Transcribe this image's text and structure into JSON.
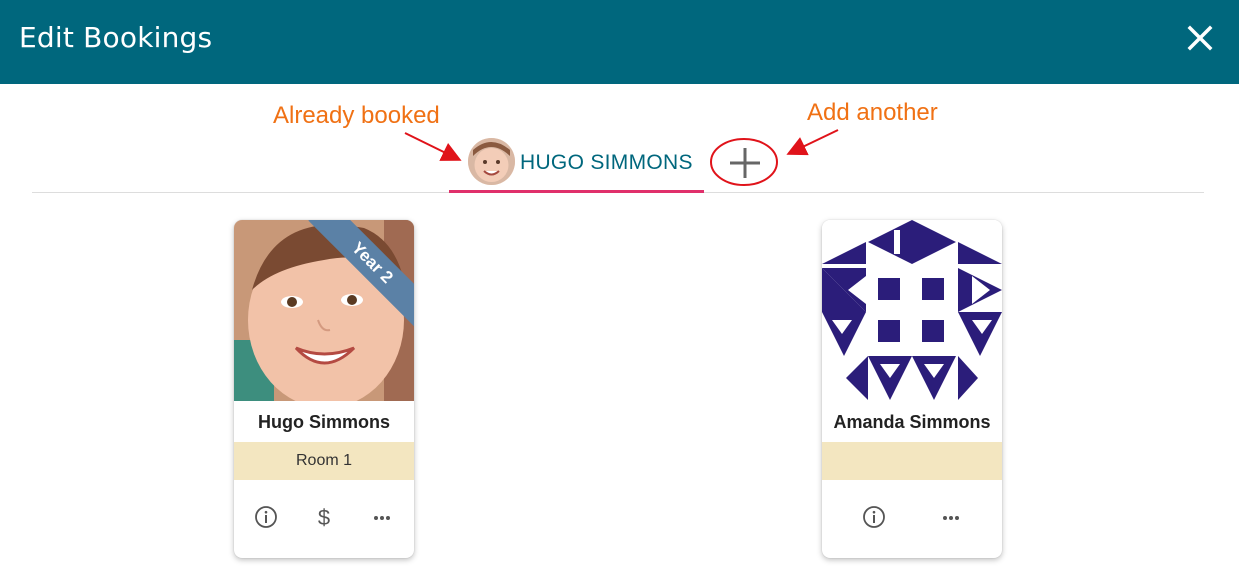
{
  "dialog": {
    "title": "Edit Bookings"
  },
  "annotations": {
    "already_booked": "Already booked",
    "add_another": "Add another"
  },
  "tabs": [
    {
      "label": "HUGO SIMMONS"
    }
  ],
  "cards": [
    {
      "name": "Hugo Simmons",
      "room": "Room 1",
      "ribbon": "Year 2"
    },
    {
      "name": "Amanda Simmons",
      "room": ""
    }
  ],
  "colors": {
    "header": "#00677d",
    "annotation": "#f07114",
    "tab_indicator": "#e0306b",
    "room_strip": "#f3e6c0",
    "ribbon": "#5b81a6",
    "identicon": "#2b1d7a"
  }
}
